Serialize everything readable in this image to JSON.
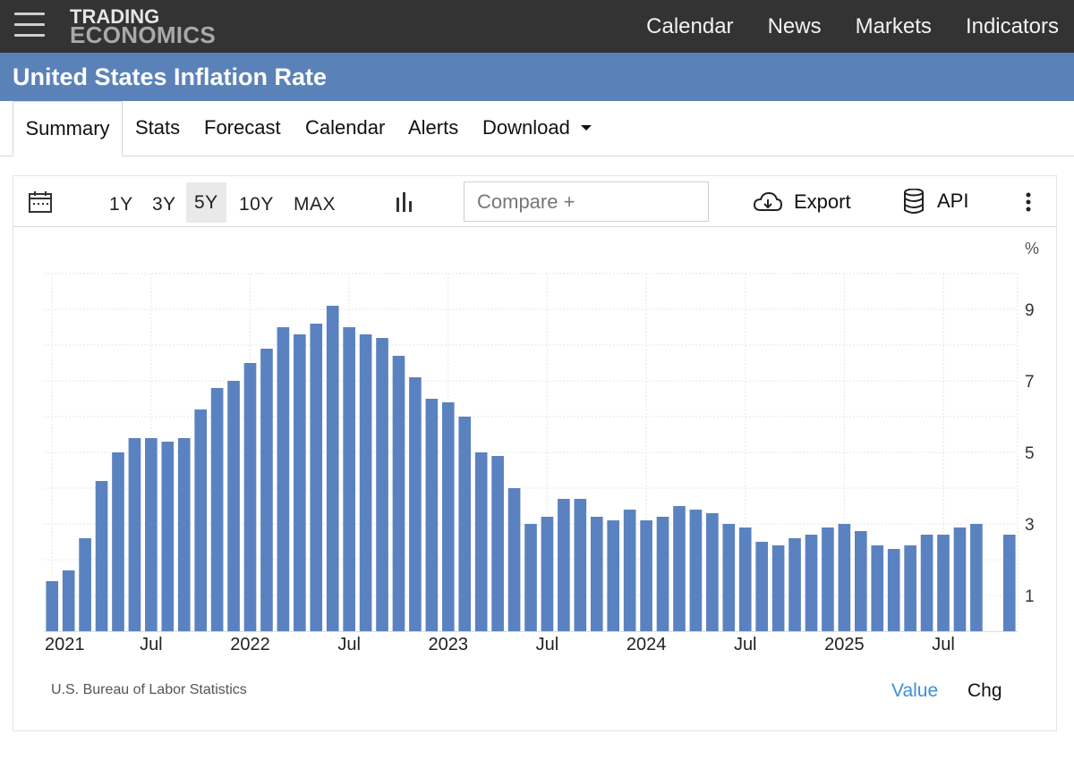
{
  "header": {
    "logo_line1": "TRADING",
    "logo_line2": "ECONOMICS",
    "nav": [
      "Calendar",
      "News",
      "Markets",
      "Indicators"
    ]
  },
  "page": {
    "title": "United States Inflation Rate"
  },
  "tabs": [
    "Summary",
    "Stats",
    "Forecast",
    "Calendar",
    "Alerts",
    "Download"
  ],
  "toolbar": {
    "ranges": [
      "1Y",
      "3Y",
      "5Y",
      "10Y",
      "MAX"
    ],
    "selected_range": "5Y",
    "compare_placeholder": "Compare +",
    "export_label": "Export",
    "api_label": "API"
  },
  "colors": {
    "bar": "#5b82c0",
    "header": "#333333",
    "titlebar": "#5b82b8",
    "accent": "#3d8fd6"
  },
  "chart_data": {
    "type": "bar",
    "unit": "%",
    "ylim": [
      0,
      10
    ],
    "yticks": [
      1,
      3,
      5,
      7,
      9
    ],
    "grid": true,
    "x_tick_labels": [
      {
        "label": "2021",
        "index": 0
      },
      {
        "label": "Jul",
        "index": 6
      },
      {
        "label": "2022",
        "index": 12
      },
      {
        "label": "Jul",
        "index": 18
      },
      {
        "label": "2023",
        "index": 24
      },
      {
        "label": "Jul",
        "index": 30
      },
      {
        "label": "2024",
        "index": 36
      },
      {
        "label": "Jul",
        "index": 42
      },
      {
        "label": "2025",
        "index": 48
      },
      {
        "label": "Jul",
        "index": 54
      }
    ],
    "values": [
      1.4,
      1.7,
      2.6,
      4.2,
      5.0,
      5.4,
      5.4,
      5.3,
      5.4,
      6.2,
      6.8,
      7.0,
      7.5,
      7.9,
      8.5,
      8.3,
      8.6,
      9.1,
      8.5,
      8.3,
      8.2,
      7.7,
      7.1,
      6.5,
      6.4,
      6.0,
      5.0,
      4.9,
      4.0,
      3.0,
      3.2,
      3.7,
      3.7,
      3.2,
      3.1,
      3.4,
      3.1,
      3.2,
      3.5,
      3.4,
      3.3,
      3.0,
      2.9,
      2.5,
      2.4,
      2.6,
      2.7,
      2.9,
      3.0,
      2.8,
      2.4,
      2.3,
      2.4,
      2.7,
      2.7,
      2.9,
      3.0,
      null,
      2.7
    ],
    "source": "U.S. Bureau of Labor Statistics",
    "toggle": [
      "Value",
      "Chg"
    ]
  }
}
